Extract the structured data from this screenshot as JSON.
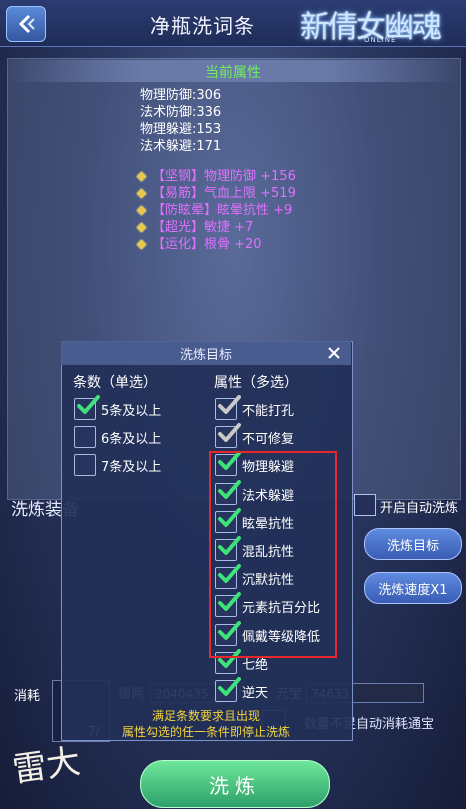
{
  "header": {
    "title": "净瓶洗词条",
    "logo_text": "新倩女幽魂",
    "logo_sub": "ONLINE"
  },
  "attributes": {
    "title": "当前属性",
    "stats": [
      "物理防御:306",
      "法术防御:336",
      "物理躲避:153",
      "法术躲避:171"
    ],
    "bonuses": [
      {
        "prefix": "【坚钢】",
        "text": "物理防御 +156"
      },
      {
        "prefix": "【易筋】",
        "text": "气血上限 +519"
      },
      {
        "prefix": "【防眩晕】",
        "text": "眩晕抗性 +9"
      },
      {
        "prefix": "【超光】",
        "text": "敏捷 +7"
      },
      {
        "prefix": "【运化】",
        "text": "根骨 +20"
      }
    ]
  },
  "equip": {
    "label": "洗炼装备",
    "consume_label": "消耗",
    "silver_label": "银两",
    "silver_value": "2040435",
    "yuanbao_label": "元宝",
    "yuanbao_value": "74633",
    "count_text": "7/",
    "auto_consume_label": "数量不足自动消耗通宝",
    "wash_button": "洗炼",
    "auto_wash_label": "开启自动洗炼",
    "target_button": "洗炼目标",
    "speed_button": "洗炼速度X1",
    "corner_logo": "雷大"
  },
  "dialog": {
    "title": "洗炼目标",
    "count_heading": "条数（单选）",
    "attr_heading": "属性（多选）",
    "count_options": [
      {
        "label": "5条及以上",
        "checked": true
      },
      {
        "label": "6条及以上",
        "checked": false
      },
      {
        "label": "7条及以上",
        "checked": false
      }
    ],
    "attr_options": [
      {
        "label": "不能打孔",
        "checked": true,
        "style": "gray"
      },
      {
        "label": "不可修复",
        "checked": true,
        "style": "gray"
      },
      {
        "label": "物理躲避",
        "checked": true,
        "style": "green"
      },
      {
        "label": "法术躲避",
        "checked": true,
        "style": "green"
      },
      {
        "label": "眩晕抗性",
        "checked": true,
        "style": "green"
      },
      {
        "label": "混乱抗性",
        "checked": true,
        "style": "green"
      },
      {
        "label": "沉默抗性",
        "checked": true,
        "style": "green"
      },
      {
        "label": "元素抗百分比",
        "checked": true,
        "style": "green"
      },
      {
        "label": "佩戴等级降低",
        "checked": true,
        "style": "green"
      },
      {
        "label": "七绝",
        "checked": true,
        "style": "green"
      },
      {
        "label": "逆天",
        "checked": true,
        "style": "green"
      }
    ],
    "hint_line1": "满足条数要求且出现",
    "hint_line2": "属性勾选的任一条件即停止洗炼"
  },
  "colors": {
    "green": "#6df05a",
    "purple": "#e070ff",
    "highlight": "#e8272b",
    "check_green": "#3ee27a",
    "check_gray": "#c9c9c9"
  },
  "icons": {
    "back": "chevron-left-icon",
    "close": "close-icon",
    "check": "check-icon",
    "gem": "diamond-icon"
  }
}
